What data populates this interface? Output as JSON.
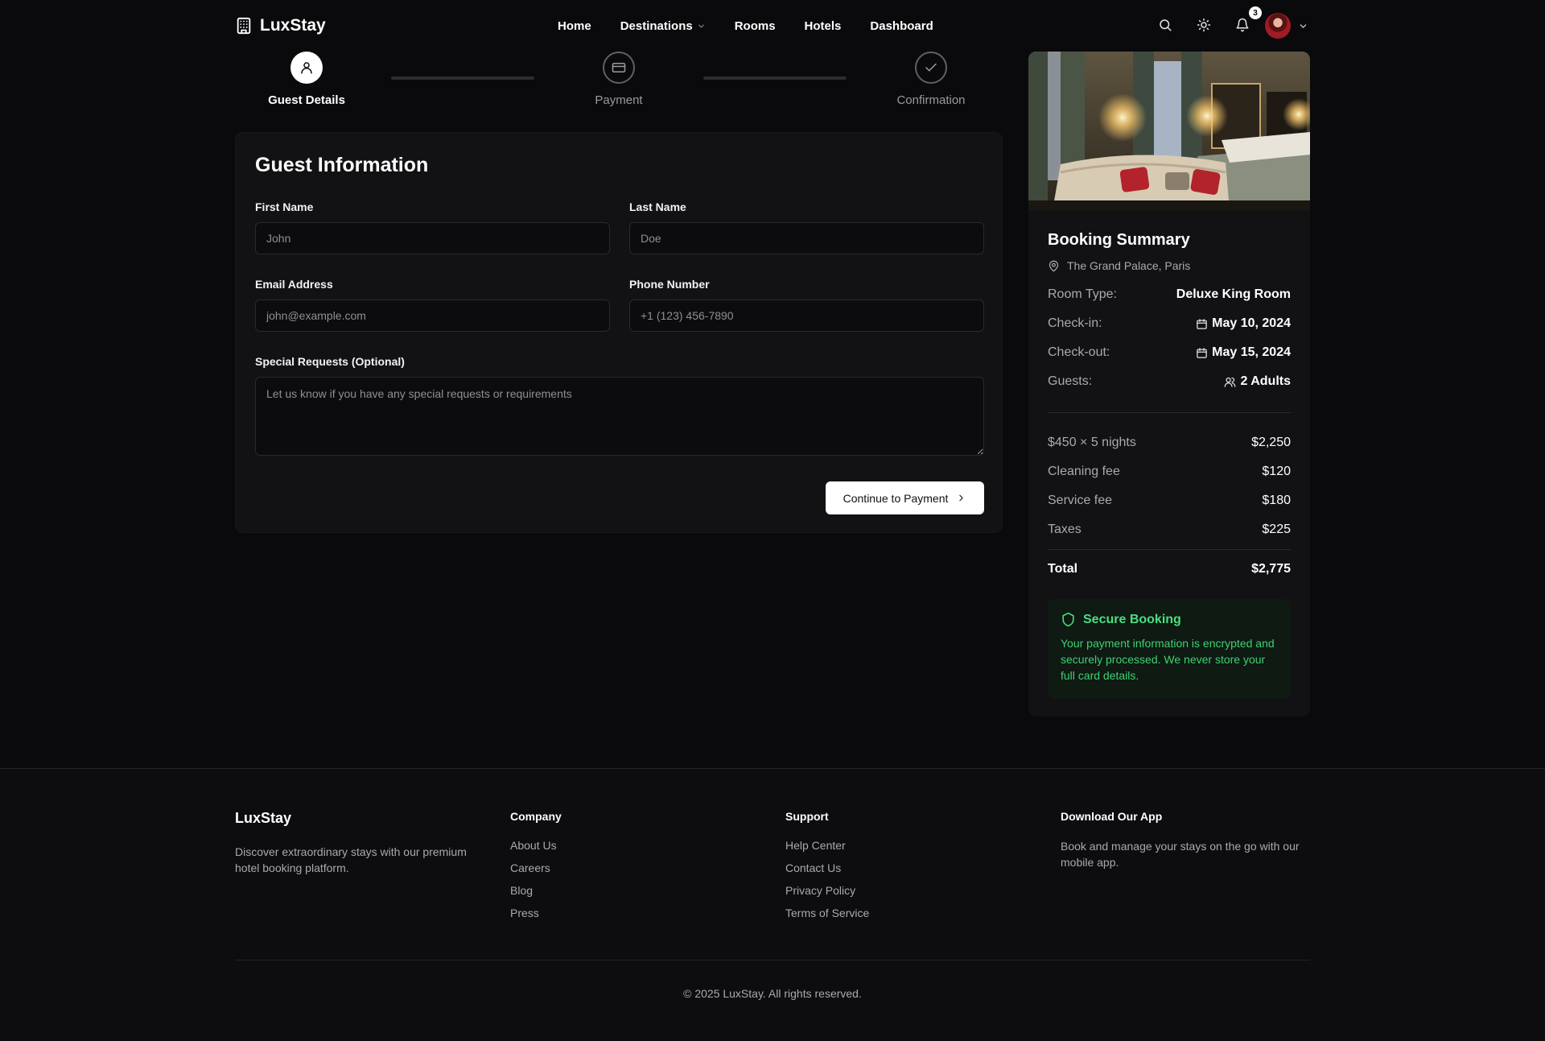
{
  "header": {
    "brand": "LuxStay",
    "nav": [
      {
        "label": "Home"
      },
      {
        "label": "Destinations"
      },
      {
        "label": "Rooms"
      },
      {
        "label": "Hotels"
      },
      {
        "label": "Dashboard"
      }
    ],
    "notification_count": "3",
    "icons": [
      "building-icon",
      "search-icon",
      "sun-icon",
      "bell-icon",
      "chevron-down-icon"
    ]
  },
  "stepper": {
    "steps": [
      {
        "label": "Guest Details",
        "state": "active",
        "icon": "user-icon"
      },
      {
        "label": "Payment",
        "state": "inactive",
        "icon": "credit-card-icon"
      },
      {
        "label": "Confirmation",
        "state": "inactive",
        "icon": "check-icon"
      }
    ]
  },
  "form": {
    "title": "Guest Information",
    "first_name": {
      "label": "First Name",
      "placeholder": "John",
      "value": ""
    },
    "last_name": {
      "label": "Last Name",
      "placeholder": "Doe",
      "value": ""
    },
    "email": {
      "label": "Email Address",
      "placeholder": "john@example.com",
      "value": ""
    },
    "phone": {
      "label": "Phone Number",
      "placeholder": "+1 (123) 456-7890",
      "value": ""
    },
    "requests": {
      "label": "Special Requests (Optional)",
      "placeholder": "Let us know if you have any special requests or requirements",
      "value": ""
    },
    "continue_label": "Continue to Payment"
  },
  "summary": {
    "title": "Booking Summary",
    "location": "The Grand Palace, Paris",
    "room_type": {
      "label": "Room Type:",
      "value": "Deluxe King Room"
    },
    "check_in": {
      "label": "Check-in:",
      "value": "May 10, 2024"
    },
    "check_out": {
      "label": "Check-out:",
      "value": "May 15, 2024"
    },
    "guests": {
      "label": "Guests:",
      "value": "2 Adults"
    },
    "charges": [
      {
        "label": "$450 × 5 nights",
        "value": "$2,250"
      },
      {
        "label": "Cleaning fee",
        "value": "$120"
      },
      {
        "label": "Service fee",
        "value": "$180"
      },
      {
        "label": "Taxes",
        "value": "$225"
      }
    ],
    "total": {
      "label": "Total",
      "value": "$2,775"
    },
    "secure": {
      "title": "Secure Booking",
      "text": "Your payment information is encrypted and securely processed. We never store your full card details."
    }
  },
  "footer": {
    "brand": "LuxStay",
    "description": "Discover extraordinary stays with our premium hotel booking platform.",
    "company": {
      "title": "Company",
      "links": [
        "About Us",
        "Careers",
        "Blog",
        "Press"
      ]
    },
    "support": {
      "title": "Support",
      "links": [
        "Help Center",
        "Contact Us",
        "Privacy Policy",
        "Terms of Service"
      ]
    },
    "app": {
      "title": "Download Our App",
      "text": "Book and manage your stays on the go with our mobile app."
    },
    "copyright": "© 2025 LuxStay. All rights reserved."
  },
  "colors": {
    "background": "#0a0a0c",
    "card": "#121214",
    "accent_green": "#4ade80",
    "text_muted": "#a9a9af"
  }
}
